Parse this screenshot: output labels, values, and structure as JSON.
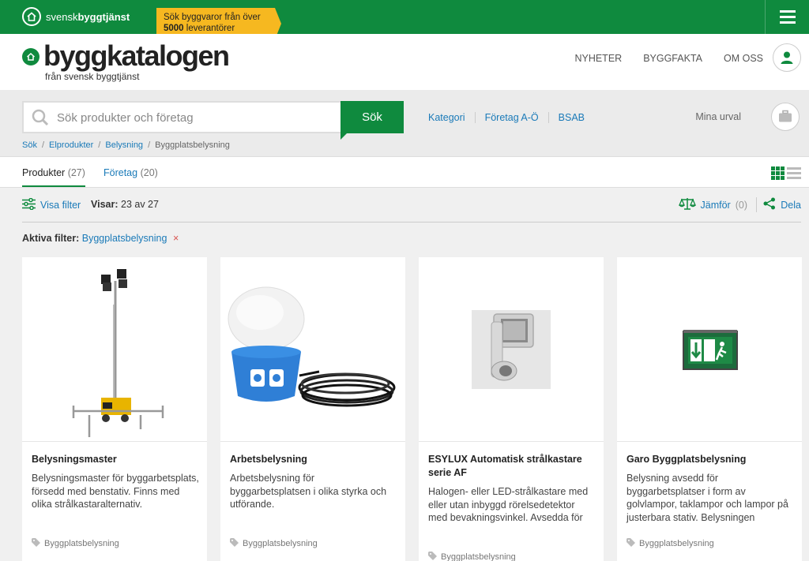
{
  "topbar": {
    "brand_a": "svensk ",
    "brand_b": "byggtjänst",
    "promo_line1": "Sök byggvaror från över",
    "promo_bold": "5000",
    "promo_line2": " leverantörer"
  },
  "header": {
    "logo_name": "byggkatalogen",
    "logo_sub": "från svensk byggtjänst",
    "nav": [
      "NYHETER",
      "BYGGFAKTA",
      "OM OSS"
    ]
  },
  "search": {
    "placeholder": "Sök produkter och företag",
    "button": "Sök",
    "links": [
      "Kategori",
      "Företag A-Ö",
      "BSAB"
    ],
    "mina_urval": "Mina urval"
  },
  "breadcrumb": {
    "items": [
      "Sök",
      "Elprodukter",
      "Belysning"
    ],
    "separator": "/",
    "current": "Byggplatsbelysning"
  },
  "tabs": {
    "produkter": "Produkter",
    "produkter_count": "(27)",
    "foretag": "Företag",
    "foretag_count": "(20)"
  },
  "filterbar": {
    "visa_filter": "Visa filter",
    "visar_label": "Visar:",
    "visar_value": "23 av 27",
    "jamfor": "Jämför",
    "jamfor_count": "(0)",
    "dela": "Dela",
    "aktiva_label": "Aktiva filter:",
    "aktiva_tag": "Byggplatsbelysning",
    "remove": "×"
  },
  "products": [
    {
      "title": "Belysningsmaster",
      "desc": "Belysningsmaster för byggarbetsplats, försedd med benstativ. Finns med olika strålkastaralternativ.",
      "category": "Byggplatsbelysning"
    },
    {
      "title": "Arbetsbelysning",
      "desc": "Arbetsbelysning för byggarbetsplatsen i olika styrka och utförande.",
      "category": "Byggplatsbelysning"
    },
    {
      "title": "ESYLUX Automatisk strålkastare serie AF",
      "desc": "Halogen- eller LED-strålkastare med eller utan inbyggd rörelsedetektor med bevakningsvinkel. Avsedda för",
      "category": "Byggplatsbelysning"
    },
    {
      "title": "Garo Byggplatsbelysning",
      "desc": "Belysning avsedd för byggarbetsplatser i form av golvlampor, taklampor och lampor på justerbara stativ. Belysningen",
      "category": "Byggplatsbelysning"
    }
  ],
  "colors": {
    "brand_green": "#0f8a3e",
    "link_blue": "#1a7ab8",
    "promo_yellow": "#f6b820"
  }
}
